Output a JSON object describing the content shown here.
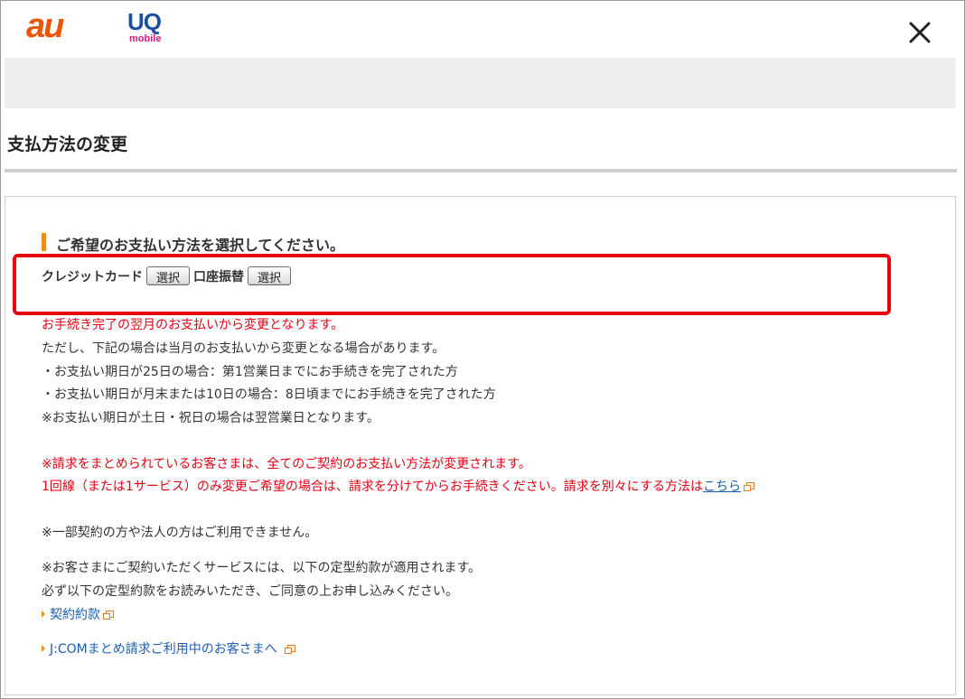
{
  "header": {
    "logo_au": "au",
    "logo_uq": "UQ",
    "logo_mobile": "mobile",
    "close_icon": "close-icon"
  },
  "page": {
    "title": "支払方法の変更"
  },
  "panel": {
    "heading": "ご希望のお支払い方法を選択してください。",
    "credit_label": "クレジットカード",
    "credit_button": "選択",
    "bank_label": "口座振替",
    "bank_button": "選択",
    "notes": {
      "n1": "お手続き完了の翌月のお支払いから変更となります。",
      "n2": "ただし、下記の場合は当月のお支払いから変更となる場合があります。",
      "n3": "・お支払い期日が25日の場合：第1営業日までにお手続きを完了された方",
      "n4": "・お支払い期日が月末または10日の場合：8日頃までにお手続きを完了された方",
      "n5": "※お支払い期日が土日・祝日の場合は翌営業日となります。",
      "n6": "※請求をまとめられているお客さまは、全てのご契約のお支払い方法が変更されます。",
      "n7": "1回線（または1サービス）のみ変更ご希望の場合は、請求を分けてからお手続きください。請求を別々にする方法は",
      "n7_link": "こちら",
      "n8": "※一部契約の方や法人の方はご利用できません。",
      "n9": "※お客さまにご契約いただくサービスには、以下の定型約款が適用されます。",
      "n10": "必ず以下の定型約款をお読みいただき、ご同意の上お申し込みください。"
    },
    "links": {
      "terms": "契約約款",
      "jcom": "J:COMまとめ請求ご利用中のお客さまへ"
    }
  },
  "colors": {
    "au_orange": "#eb5505",
    "uq_blue": "#1e50a0",
    "uq_pink": "#d6197e",
    "highlight_red": "#e8000d",
    "notice_red": "#e60012",
    "link_blue": "#1a5fb4"
  }
}
